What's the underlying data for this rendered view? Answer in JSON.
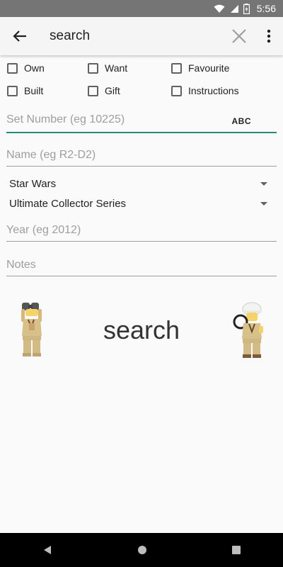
{
  "status": {
    "time": "5:56"
  },
  "appbar": {
    "title": "search"
  },
  "filters": [
    {
      "label": "Own"
    },
    {
      "label": "Want"
    },
    {
      "label": "Favourite"
    },
    {
      "label": "Built"
    },
    {
      "label": "Gift"
    },
    {
      "label": "Instructions"
    }
  ],
  "fields": {
    "set_number_placeholder": "Set Number (eg 10225)",
    "keyboard_toggle": "ABC",
    "name_placeholder": "Name (eg R2-D2)",
    "theme": "Star Wars",
    "subtheme": "Ultimate Collector Series",
    "year_placeholder": "Year (eg 2012)",
    "notes_placeholder": "Notes"
  },
  "search_button": "search",
  "colors": {
    "accent": "#26897a",
    "statusbar": "#757575",
    "appbar": "#f5f5f5"
  },
  "icons": [
    "wifi-icon",
    "signal-icon",
    "battery-icon",
    "back-arrow-icon",
    "clear-icon",
    "more-vert-icon",
    "minifig-binoculars-icon",
    "minifig-magnifier-icon",
    "nav-back-icon",
    "nav-home-icon",
    "nav-recents-icon"
  ]
}
